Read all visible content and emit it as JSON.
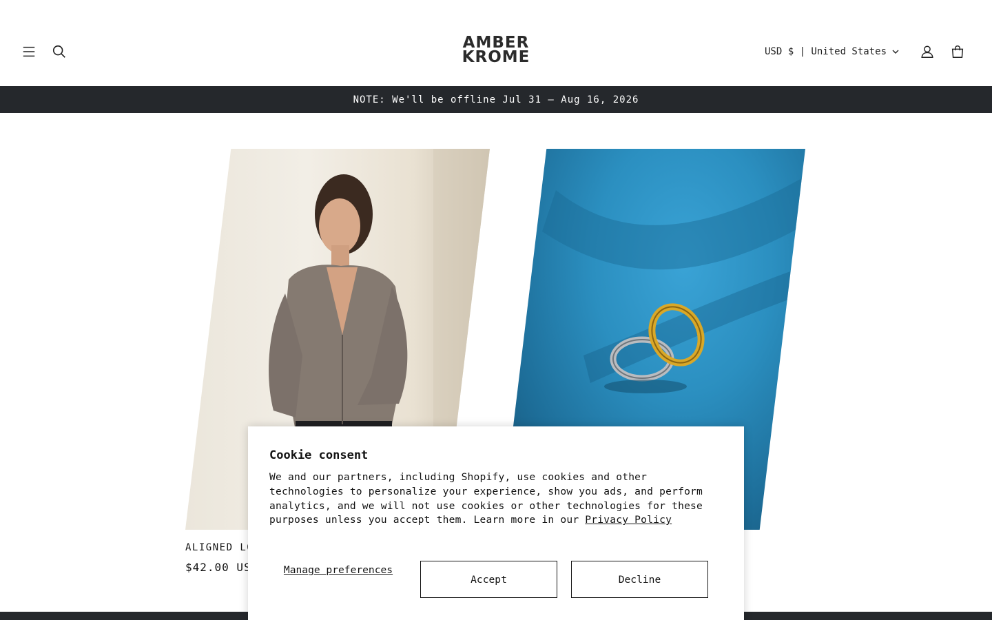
{
  "header": {
    "logo_line1": "AMBER",
    "logo_line2": "KROME",
    "currency_label": "USD $ | United States",
    "icons": {
      "menu": "hamburger-menu-icon",
      "search": "search-icon",
      "account": "account-icon",
      "cart": "cart-icon",
      "currency_chevron": "chevron-down-icon"
    }
  },
  "announcement": {
    "text": "NOTE: We'll be offline Jul 31 – Aug 16, 2026"
  },
  "products": [
    {
      "title": "ALIGNED LON",
      "price": "$42.00 US"
    },
    {
      "title": "",
      "price": ""
    }
  ],
  "cookie_banner": {
    "title": "Cookie consent",
    "body": "We and our partners, including Shopify, use cookies and other technologies to personalize your experience, show you ads, and perform analytics, and we will not use cookies or other technologies for these purposes unless you accept them. Learn more in our ",
    "privacy_link": "Privacy Policy",
    "manage_label": "Manage preferences",
    "accept_label": "Accept",
    "decline_label": "Decline"
  },
  "colors": {
    "announcement_bg": "#25282c",
    "text": "#121212",
    "rings_bg": "#2b8fc0"
  }
}
